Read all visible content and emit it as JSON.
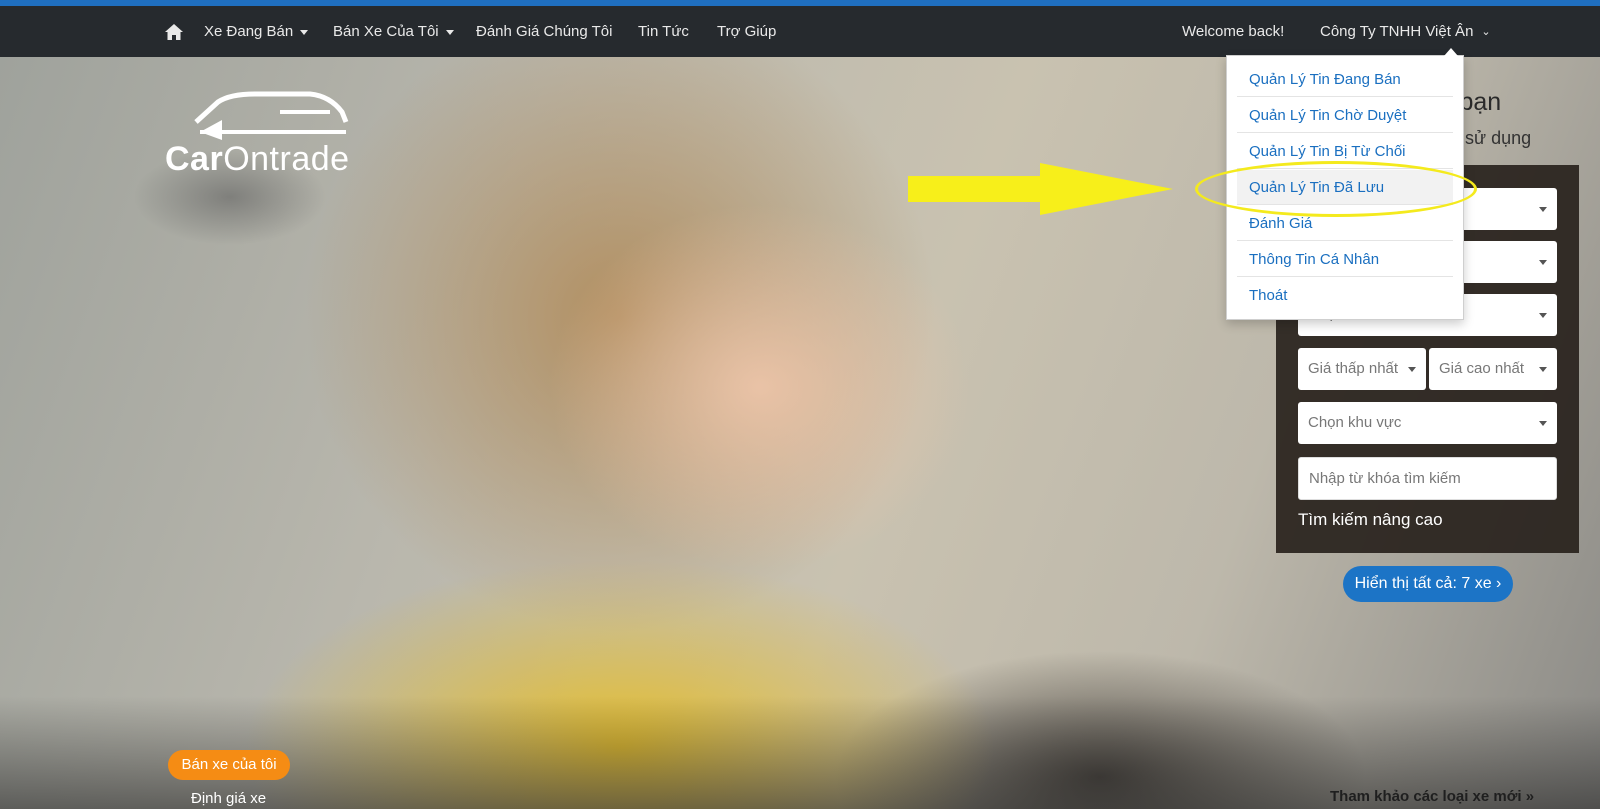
{
  "nav": {
    "home_icon": "home-icon",
    "items": [
      {
        "label": "Xe Đang Bán",
        "dropdown": true
      },
      {
        "label": "Bán Xe Của Tôi",
        "dropdown": true
      },
      {
        "label": "Đánh Giá Chúng Tôi",
        "dropdown": false
      },
      {
        "label": "Tin Tức",
        "dropdown": false
      },
      {
        "label": "Trợ Giúp",
        "dropdown": false
      }
    ],
    "welcome": "Welcome back!",
    "account": "Công Ty TNHH Việt Ân"
  },
  "account_menu": {
    "items": [
      {
        "label": "Quản Lý Tin Đang Bán"
      },
      {
        "label": "Quản Lý Tin Chờ Duyệt"
      },
      {
        "label": "Quản Lý Tin Bị Từ Chối"
      },
      {
        "label": "Quản Lý Tin Đã Lưu",
        "highlighted": true
      },
      {
        "label": "Đánh Giá"
      },
      {
        "label": "Thông Tin Cá Nhân"
      },
      {
        "label": "Thoát"
      }
    ]
  },
  "logo": {
    "text_bold": "Car",
    "text_regular": "Ontrade"
  },
  "hero": {
    "title_partial": "ý bạn",
    "subtitle_partial": "ã sử dụng"
  },
  "search": {
    "brand_select": "",
    "model_select": "",
    "year_select": "Chọn năm xe",
    "price_min": "Giá thấp nhất",
    "price_max": "Giá cao nhất",
    "region": "Chọn khu vực",
    "keyword_placeholder": "Nhập từ khóa tìm kiếm",
    "advanced": "Tìm kiếm nâng cao",
    "show_all": "Hiển thị tất cả: 7 xe ›"
  },
  "bottom": {
    "sell_button": "Bán xe của tôi",
    "price_link": "Định giá xe",
    "ref_link": "Tham khảo các loại xe mới »"
  },
  "colors": {
    "navbar": "#262a2e",
    "top_accent": "#1f6fc0",
    "link_blue": "#1a6fc0",
    "annotation_yellow": "#f4ea1d",
    "orange": "#f58c14"
  }
}
